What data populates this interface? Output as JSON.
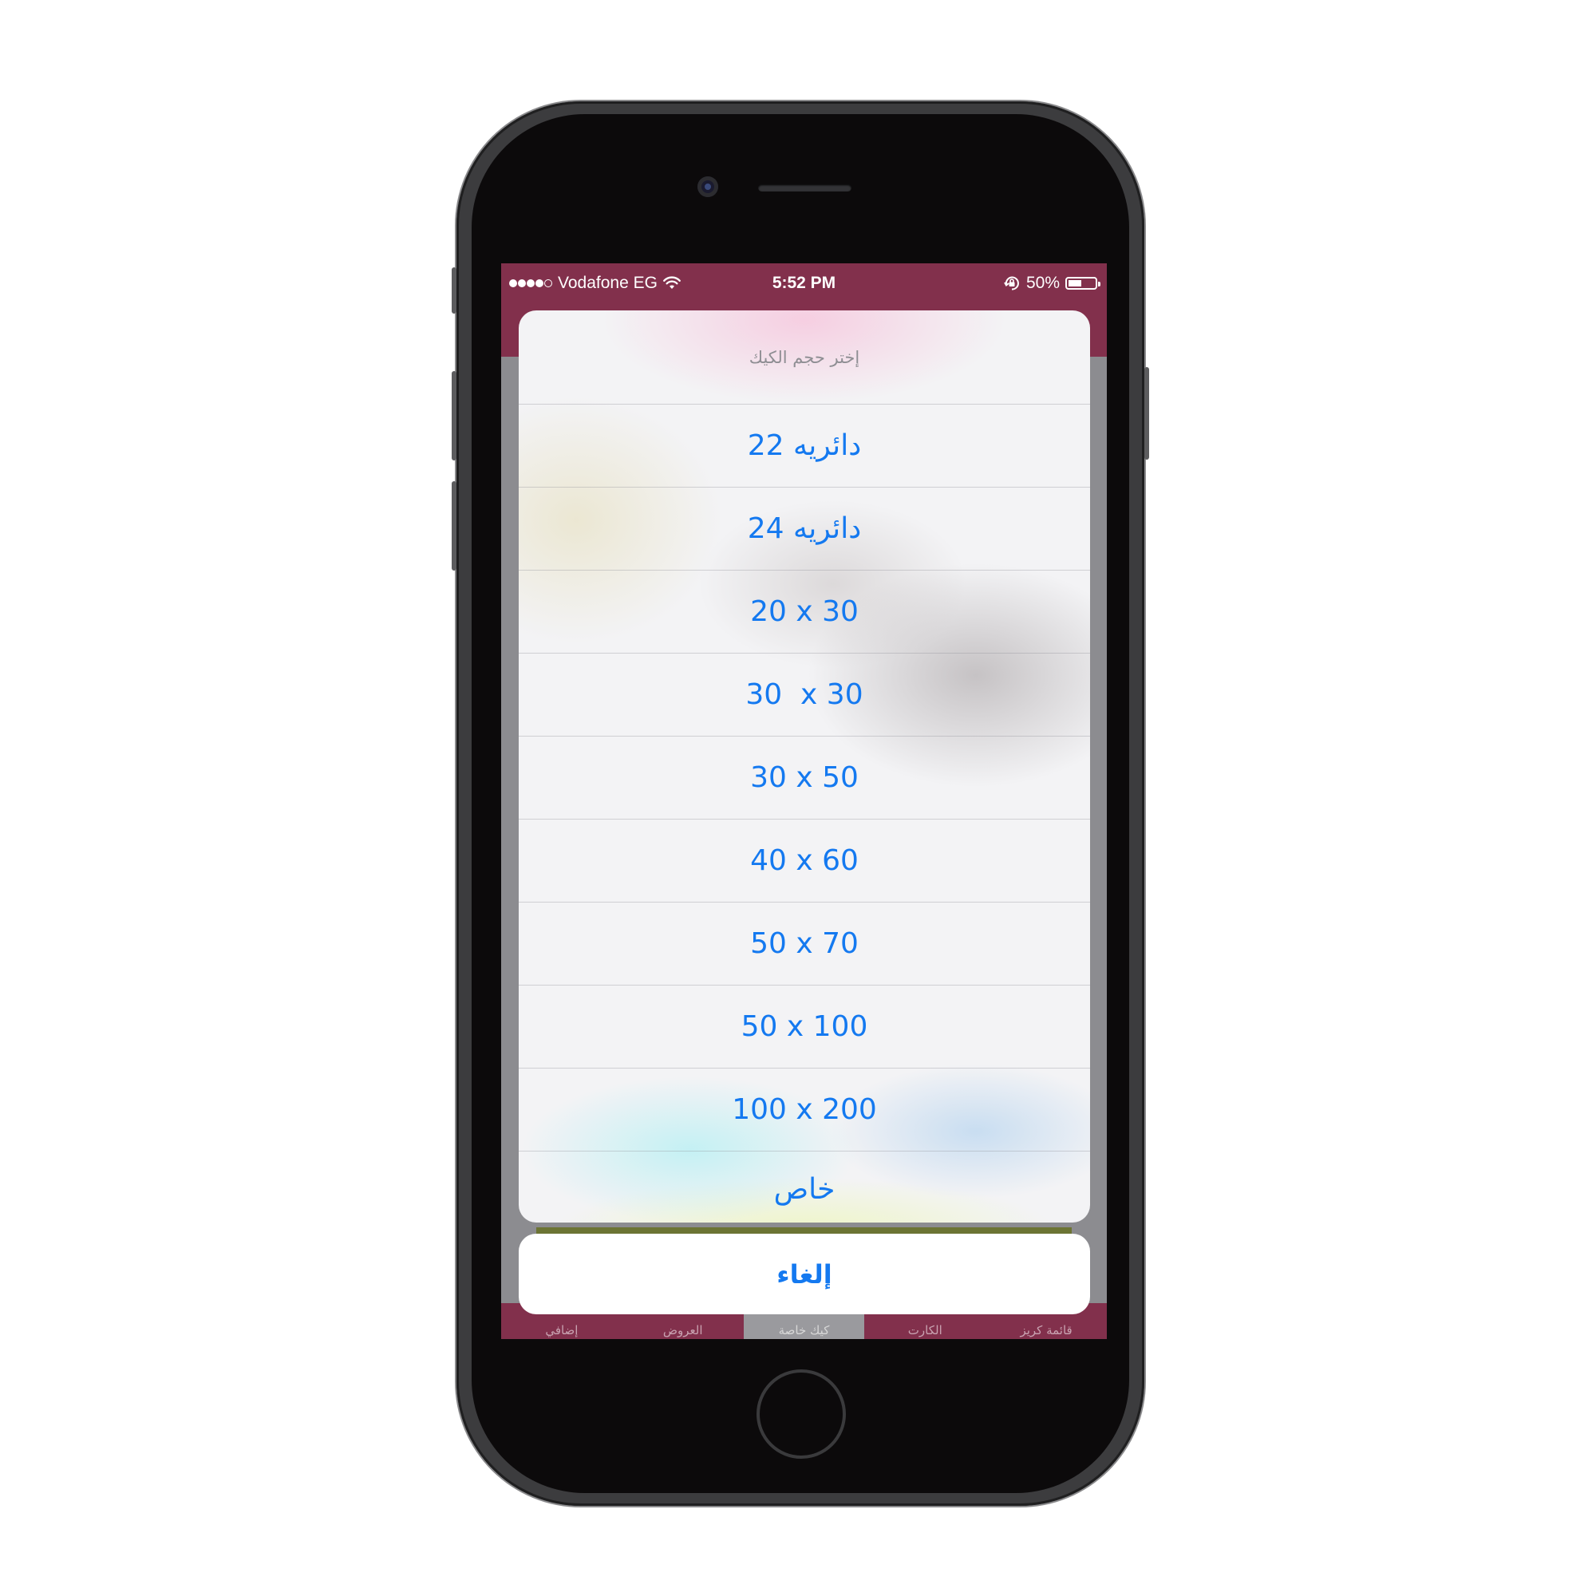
{
  "status_bar": {
    "carrier": "Vodafone EG",
    "time": "5:52 PM",
    "battery_percent": "50%",
    "battery_level": 0.5,
    "signal_bars_filled": 4,
    "signal_bars_total": 5
  },
  "action_sheet": {
    "title": "إختر حجم الكيك",
    "options": [
      "22 دائريه",
      "24 دائريه",
      "20 x 30",
      "30  x 30",
      "30 x 50",
      "40 x 60",
      "50 x 70",
      "50 x 100",
      "100 x 200",
      "خاص"
    ],
    "cancel_label": "إلغاء"
  },
  "tab_bar": {
    "tabs": [
      "إضافي",
      "العروض",
      "كيك خاصة",
      "الكارت",
      "قائمة كريز"
    ],
    "active_index": 2
  },
  "colors": {
    "brand": "#82304c",
    "accent": "#1479f0",
    "olive": "#6c7434"
  },
  "icons": {
    "wifi": "wifi-icon",
    "orientation_lock": "orientation-lock-icon",
    "battery": "battery-icon"
  }
}
